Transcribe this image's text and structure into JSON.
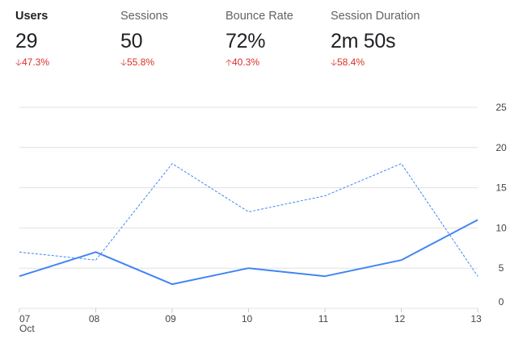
{
  "metrics": [
    {
      "label": "Users",
      "value": "29",
      "change": "47.3%",
      "direction": "down",
      "active": true
    },
    {
      "label": "Sessions",
      "value": "50",
      "change": "55.8%",
      "direction": "down",
      "active": false
    },
    {
      "label": "Bounce Rate",
      "value": "72%",
      "change": "40.3%",
      "direction": "up",
      "active": false
    },
    {
      "label": "Session Duration",
      "value": "2m 50s",
      "change": "58.4%",
      "direction": "down",
      "active": false
    }
  ],
  "chart_data": {
    "type": "line",
    "categories": [
      "07",
      "08",
      "09",
      "10",
      "11",
      "12",
      "13"
    ],
    "x_sublabel": "Oct",
    "y_ticks": [
      0,
      5,
      10,
      15,
      20,
      25
    ],
    "ylim": [
      0,
      25
    ],
    "grid": true,
    "y_axis_side": "right",
    "series": [
      {
        "values": [
          4,
          7,
          3,
          5,
          4,
          6,
          11
        ],
        "style": "solid",
        "color": "#4285f4"
      },
      {
        "values": [
          7,
          6,
          18,
          12,
          14,
          18,
          4
        ],
        "style": "dashed",
        "color": "#4285f4"
      }
    ]
  },
  "colors": {
    "accent": "#4285f4",
    "negative": "#d93025",
    "grid": "#e0e0e0"
  }
}
